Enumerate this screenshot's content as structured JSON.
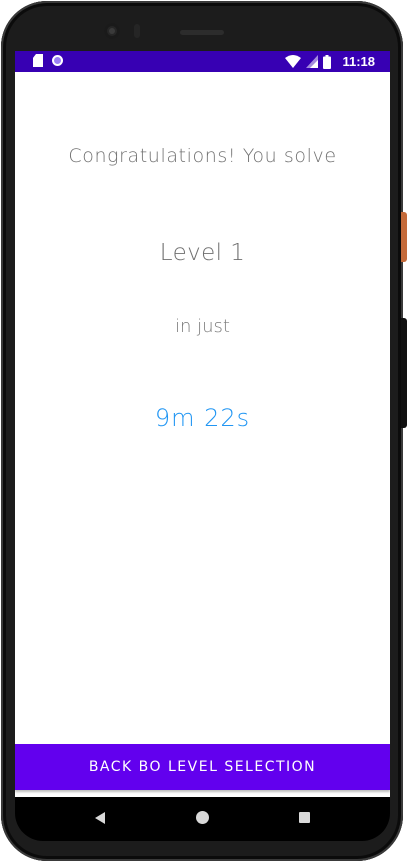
{
  "status_bar": {
    "time": "11:18",
    "background_color": "#3700b3",
    "icons_left": [
      "sim-card-icon",
      "notification-dot-icon"
    ],
    "icons_right": [
      "wifi-icon",
      "cell-signal-icon",
      "battery-icon"
    ]
  },
  "main": {
    "congrats_text": "Congratulations! You solve",
    "level_text": "Level 1",
    "in_just_text": "in just",
    "time_text": "9m 22s",
    "time_color": "#2196f3"
  },
  "back_button": {
    "label": "BACK BO LEVEL SELECTION",
    "background_color": "#6200ee"
  },
  "navigation_bar": {
    "icons": [
      "back-icon",
      "home-icon",
      "recents-icon"
    ]
  }
}
